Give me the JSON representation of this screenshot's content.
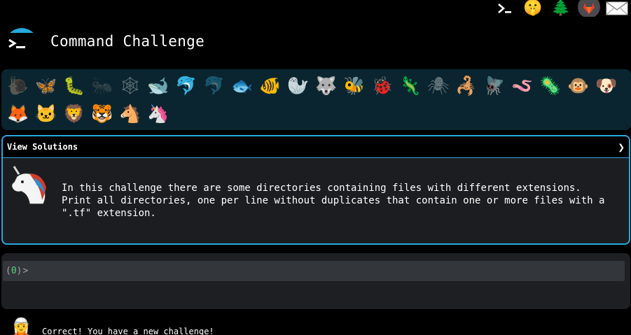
{
  "app": {
    "title": "Command Challenge"
  },
  "top_icons": [
    {
      "name": "terminal-icon",
      "glyph": "terminal"
    },
    {
      "name": "shushing-face-icon",
      "glyph": "🤫"
    },
    {
      "name": "christmas-tree-icon",
      "glyph": "🌲"
    },
    {
      "name": "gitlab-icon",
      "glyph": "gitlab"
    },
    {
      "name": "envelope-icon",
      "glyph": "envelope"
    }
  ],
  "animals": [
    {
      "name": "snail",
      "glyph": "🐌",
      "dim": true
    },
    {
      "name": "butterfly",
      "glyph": "🦋",
      "dim": false
    },
    {
      "name": "caterpillar",
      "glyph": "🐛",
      "dim": false
    },
    {
      "name": "ant",
      "glyph": "🐜",
      "dim": true
    },
    {
      "name": "spider-web",
      "glyph": "🕸",
      "dim": true
    },
    {
      "name": "whale",
      "glyph": "🐋",
      "dim": false
    },
    {
      "name": "dolphin",
      "glyph": "🐬",
      "dim": false
    },
    {
      "name": "dolphin-2",
      "glyph": "🐬",
      "dim": true
    },
    {
      "name": "fish",
      "glyph": "🐟",
      "dim": false
    },
    {
      "name": "tropical-fish",
      "glyph": "🐠",
      "dim": false
    },
    {
      "name": "walrus",
      "glyph": "🦭",
      "dim": false
    },
    {
      "name": "wolf",
      "glyph": "🐺",
      "dim": false
    },
    {
      "name": "bee",
      "glyph": "🐝",
      "dim": false
    },
    {
      "name": "ladybug",
      "glyph": "🐞",
      "dim": false
    },
    {
      "name": "lizard",
      "glyph": "🦎",
      "dim": false
    },
    {
      "name": "spider",
      "glyph": "🕷",
      "dim": true
    },
    {
      "name": "scorpion",
      "glyph": "🦂",
      "dim": false
    },
    {
      "name": "fly",
      "glyph": "🪰",
      "dim": false
    },
    {
      "name": "worm",
      "glyph": "🪱",
      "dim": false
    },
    {
      "name": "microbe",
      "glyph": "🦠",
      "dim": false
    },
    {
      "name": "monkey",
      "glyph": "🐵",
      "dim": false
    },
    {
      "name": "dog",
      "glyph": "🐶",
      "dim": false
    },
    {
      "name": "fox",
      "glyph": "🦊",
      "dim": false
    },
    {
      "name": "cat",
      "glyph": "🐱",
      "dim": false
    },
    {
      "name": "lion",
      "glyph": "🦁",
      "dim": false
    },
    {
      "name": "tiger",
      "glyph": "🐯",
      "dim": false
    },
    {
      "name": "horse",
      "glyph": "🐴",
      "dim": false
    },
    {
      "name": "unicorn",
      "glyph": "🦄",
      "dim": false
    }
  ],
  "solutions": {
    "label": "View Solutions",
    "toggle": "❯"
  },
  "challenge": {
    "mascot": "unicorn",
    "line1": "In this challenge there are some directories containing files with different extensions.",
    "line2": "Print all directories, one per line without duplicates that contain one or more files with a",
    "line3": "\".tf\" extension."
  },
  "terminal": {
    "paren_open": "(",
    "exit_status": "0",
    "paren_close": ")",
    "prompt": ">",
    "status_color": "#4ed97b"
  },
  "footer": {
    "mascot": "🧝",
    "message": "Correct! You have a new challenge!"
  },
  "colors": {
    "accent": "#29a8e0",
    "background": "#000000",
    "animal_strip": "#0a2530",
    "card": "#1c1d20"
  }
}
